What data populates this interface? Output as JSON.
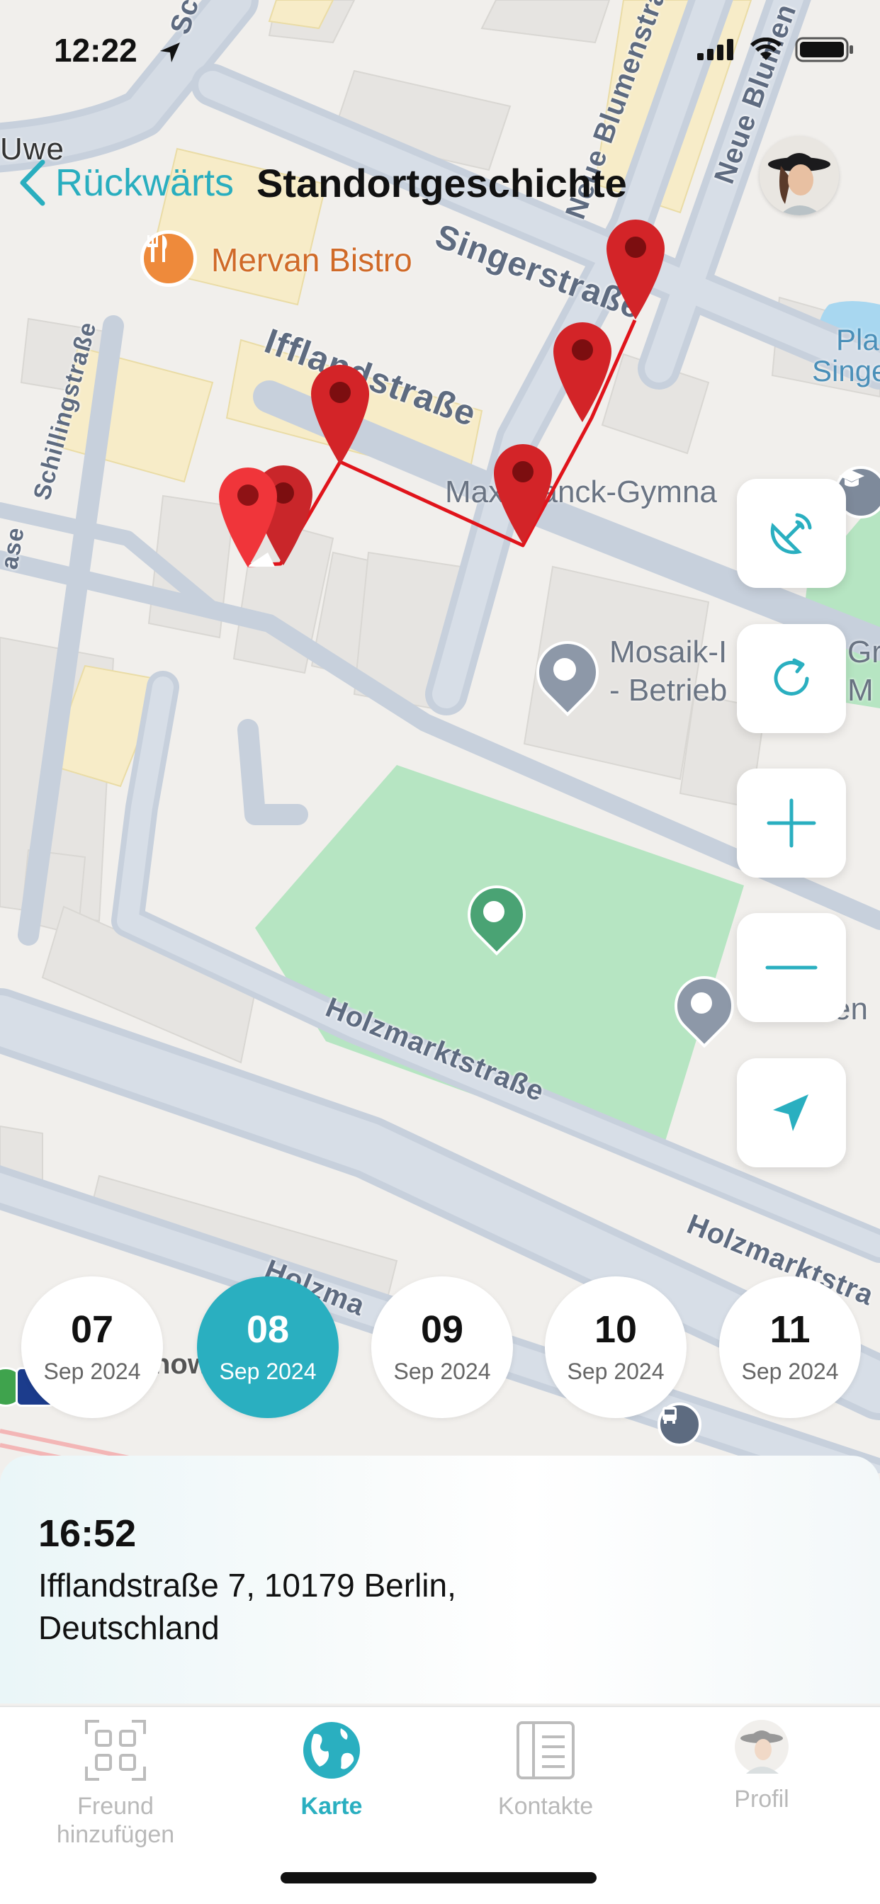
{
  "status_bar": {
    "time": "12:22"
  },
  "nav": {
    "back_label": "Rückwärts",
    "title": "Standortgeschichte"
  },
  "map": {
    "labels": {
      "mervan": "Mervan Bistro",
      "uwe": "Uwe",
      "singer": "Singerstraße",
      "ifflands": "Ifflandstraße",
      "neue_blumen_1": "Neue Blumenstra",
      "neue_blumen_2": "Neue Blumen",
      "schilling": "Schillingstraße",
      "schill_top": "Schil",
      "max_planck": "Max Planck-Gymna",
      "mosaik_1": "Mosaik-I",
      "mosaik_2": "- Betrieb",
      "mosaik_right_1": "Gr",
      "mosaik_right_2": "M",
      "holzmarkt_1": "Holzmarktstraße",
      "holzmarkt_2": "Holzmarktstra",
      "holzmarkt_3": "Holzma",
      "pla": "Pla",
      "singe": "Singe",
      "jannowitz": "nowit",
      "cen": "en",
      "ase": "ase"
    }
  },
  "dates": [
    {
      "day": "07",
      "month": "Sep 2024",
      "active": false
    },
    {
      "day": "08",
      "month": "Sep 2024",
      "active": true
    },
    {
      "day": "09",
      "month": "Sep 2024",
      "active": false
    },
    {
      "day": "10",
      "month": "Sep 2024",
      "active": false
    },
    {
      "day": "11",
      "month": "Sep 2024",
      "active": false
    }
  ],
  "detail": {
    "time": "16:52",
    "address": "Ifflandstraße 7, 10179 Berlin, Deutschland"
  },
  "tabs": [
    {
      "label": "Freund\nhinzufügen",
      "icon": "qr-code-icon",
      "active": false
    },
    {
      "label": "Karte",
      "icon": "globe-icon",
      "active": true
    },
    {
      "label": "Kontakte",
      "icon": "contacts-icon",
      "active": false
    },
    {
      "label": "Profil",
      "icon": "profile-avatar-icon",
      "active": false
    }
  ],
  "colors": {
    "accent": "#2aafc0",
    "route": "#e0141b",
    "pin": "#d32428",
    "park": "#b6e5c2"
  }
}
